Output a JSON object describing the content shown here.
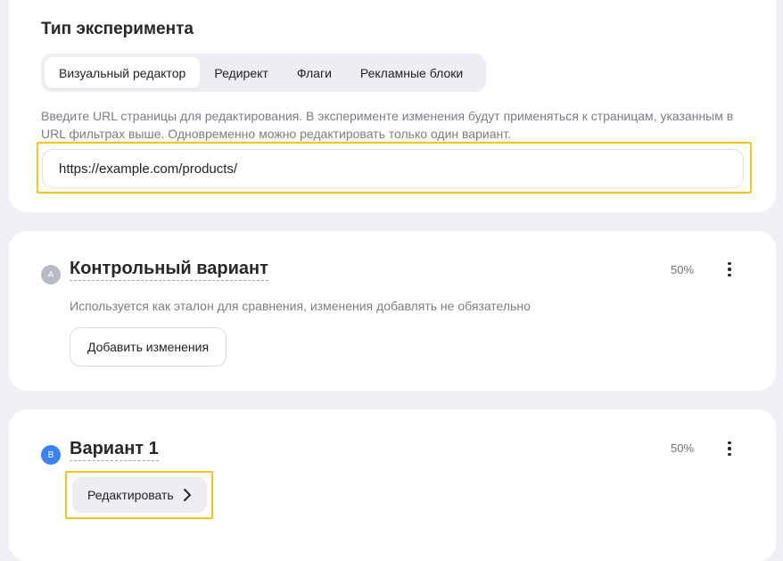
{
  "experiment_type": {
    "title": "Тип эксперимента",
    "tabs": [
      {
        "label": "Визуальный редактор",
        "active": true
      },
      {
        "label": "Редирект",
        "active": false
      },
      {
        "label": "Флаги",
        "active": false
      },
      {
        "label": "Рекламные блоки",
        "active": false
      }
    ],
    "hint": "Введите URL страницы для редактирования. В эксперименте изменения будут применяться к страницам, указанным в URL фильтрах выше. Одновременно можно редактировать только один вариант.",
    "url_value": "https://example.com/products/"
  },
  "variant_a": {
    "badge": "A",
    "title": "Контрольный вариант",
    "percent": "50%",
    "description": "Используется как эталон для сравнения, изменения добавлять не обязательно",
    "button_label": "Добавить изменения"
  },
  "variant_b": {
    "badge": "B",
    "title": "Вариант 1",
    "percent": "50%",
    "button_label": "Редактировать"
  },
  "colors": {
    "highlight": "#f6c519",
    "badge_a": "#b6bac4",
    "badge_b": "#3b82f6",
    "background": "#eef0f4"
  },
  "icons": [
    "more-vertical-icon",
    "chevron-right-icon"
  ]
}
